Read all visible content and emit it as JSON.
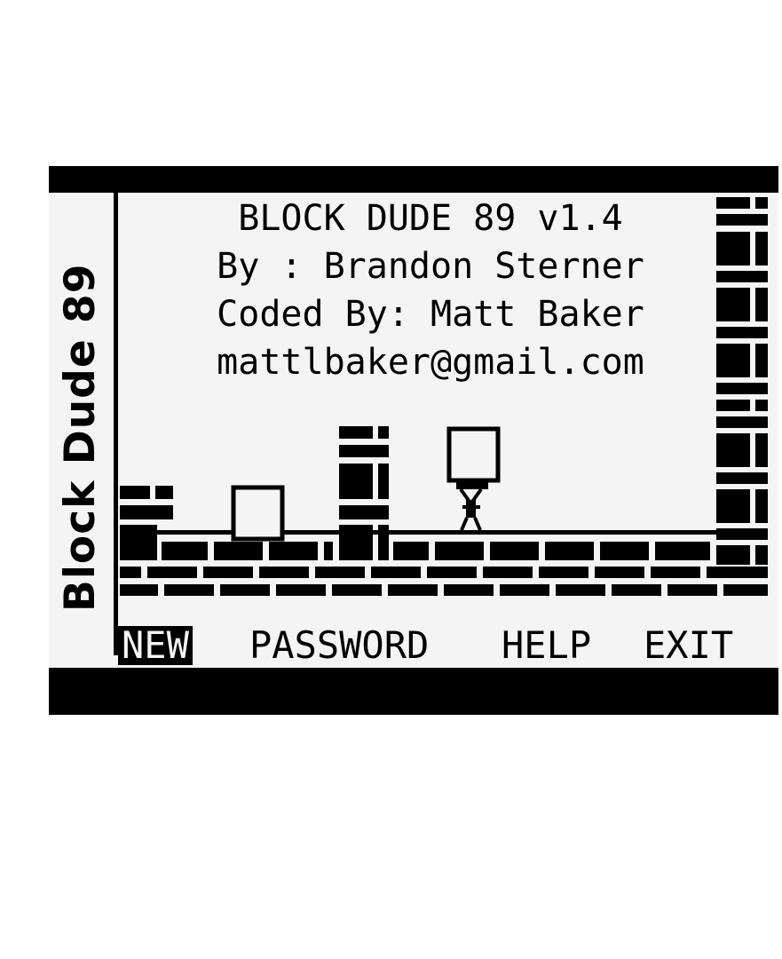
{
  "side_title": "Block Dude 89",
  "info": {
    "title": "BLOCK DUDE 89 v1.4",
    "author": "By : Brandon Sterner",
    "coder": "Coded By: Matt Baker",
    "email": "mattlbaker@gmail.com"
  },
  "menu": {
    "items": [
      "NEW",
      "PASSWORD",
      "HELP",
      "EXIT"
    ],
    "selected": "NEW"
  },
  "colors": {
    "lcd_background": "#f4f4f4",
    "pixel": "#000000"
  }
}
